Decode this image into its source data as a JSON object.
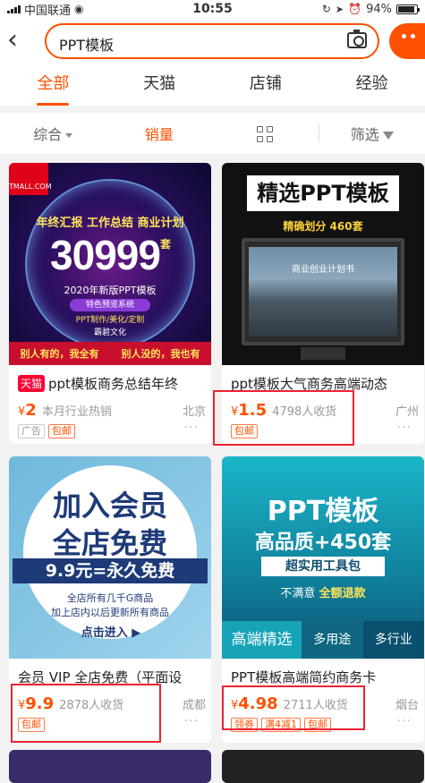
{
  "status": {
    "carrier": "中国联通",
    "time": "10:55",
    "battery": "94%"
  },
  "search": {
    "query": "PPT模板"
  },
  "tabs": [
    "全部",
    "天猫",
    "店铺",
    "经验"
  ],
  "sort": {
    "comprehensive": "综合",
    "sales": "销量",
    "filter": "筛选"
  },
  "products": [
    {
      "badge": "天猫",
      "title": "ppt模板商务总结年终",
      "price_symbol": "¥",
      "price": "2",
      "sales": "本月行业热销",
      "location": "北京",
      "tags": [
        "广告",
        "包邮"
      ],
      "image": {
        "store": "TMALL.COM",
        "line1": "年终汇报 工作总结 商业计划",
        "big_number": "30999",
        "suffix": "套",
        "sub": "2020年新版PPT模板",
        "ribbon": "特色预览系统",
        "services": "PPT制作/美化/定制",
        "brand": "霸碧文化",
        "bottom_left": "别人有的，我全有",
        "bottom_right": "别人没的，我也有"
      }
    },
    {
      "title": "ppt模板大气商务高端动态",
      "price_symbol": "¥",
      "price": "1.5",
      "sales": "4798人收货",
      "location": "广州",
      "tags": [
        "包邮"
      ],
      "image": {
        "headline": "精选PPT模板",
        "sub": "精确划分 460套",
        "screen": "商业创业计划书"
      }
    },
    {
      "title": "会员 VIP 全店免费（平面设",
      "price_symbol": "¥",
      "price": "9.9",
      "sales": "2878人收货",
      "location": "成都",
      "tags": [
        "包邮"
      ],
      "image": {
        "line1": "加入会员",
        "line2": "全店免费",
        "line3": "9.9元=永久免费",
        "line4": "全店所有几千G商品",
        "line5": "加上店内以后更新所有商品",
        "cta": "点击进入"
      }
    },
    {
      "title": "PPT模板高端简约商务卡",
      "price_symbol": "¥",
      "price": "4.98",
      "sales": "2711人收货",
      "location": "烟台",
      "tags": [
        "领券",
        "满4减1",
        "包邮"
      ],
      "image": {
        "headline": "PPT模板",
        "sub": "高品质+450套",
        "ribbon": "超实用工具包",
        "note": "不满意",
        "note_highlight": "全额退款",
        "bar_left": "高端精选",
        "bar_mid": "多用途",
        "bar_right": "多行业"
      }
    }
  ]
}
